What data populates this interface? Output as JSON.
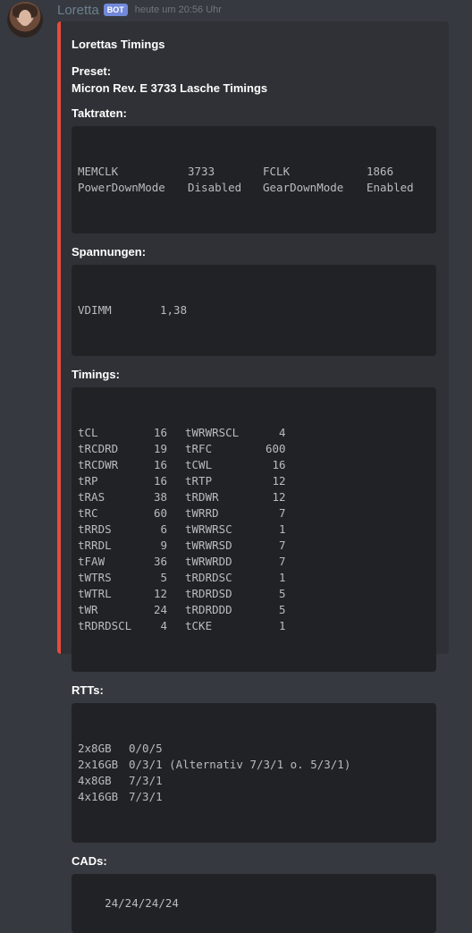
{
  "message": {
    "username": "Loretta",
    "bot_tag": "BOT",
    "timestamp": "heute um 20:56 Uhr"
  },
  "embed": {
    "accent_color": "#e74c3c",
    "title": "Lorettas Timings",
    "preset_label": "Preset:",
    "preset_value": "Micron Rev. E 3733 Lasche Timings",
    "taktraten_label": "Taktraten:",
    "taktraten": [
      [
        "MEMCLK",
        "3733",
        "FCLK",
        "1866"
      ],
      [
        "PowerDownMode",
        "Disabled",
        "GearDownMode",
        "Enabled"
      ]
    ],
    "spannungen_label": "Spannungen:",
    "spannungen": [
      [
        "VDIMM",
        "1,38"
      ]
    ],
    "timings_label": "Timings:",
    "timings": [
      [
        "tCL",
        "16",
        "tWRWRSCL",
        "4"
      ],
      [
        "tRCDRD",
        "19",
        "tRFC",
        "600"
      ],
      [
        "tRCDWR",
        "16",
        "tCWL",
        "16"
      ],
      [
        "tRP",
        "16",
        "tRTP",
        "12"
      ],
      [
        "tRAS",
        "38",
        "tRDWR",
        "12"
      ],
      [
        "tRC",
        "60",
        "tWRRD",
        "7"
      ],
      [
        "tRRDS",
        "6",
        "tWRWRSC",
        "1"
      ],
      [
        "tRRDL",
        "9",
        "tWRWRSD",
        "7"
      ],
      [
        "tFAW",
        "36",
        "tWRWRDD",
        "7"
      ],
      [
        "tWTRS",
        "5",
        "tRDRDSC",
        "1"
      ],
      [
        "tWTRL",
        "12",
        "tRDRDSD",
        "5"
      ],
      [
        "tWR",
        "24",
        "tRDRDDD",
        "5"
      ],
      [
        "tRDRDSCL",
        "4",
        "tCKE",
        "1"
      ]
    ],
    "rtts_label": "RTTs:",
    "rtts": [
      [
        "2x8GB",
        "0/0/5"
      ],
      [
        "2x16GB",
        "0/3/1 (Alternativ 7/3/1 o. 5/3/1)"
      ],
      [
        "4x8GB",
        "7/3/1"
      ],
      [
        "4x16GB",
        "7/3/1"
      ]
    ],
    "cads_label": "CADs:",
    "cads_value": "24/24/24/24"
  }
}
